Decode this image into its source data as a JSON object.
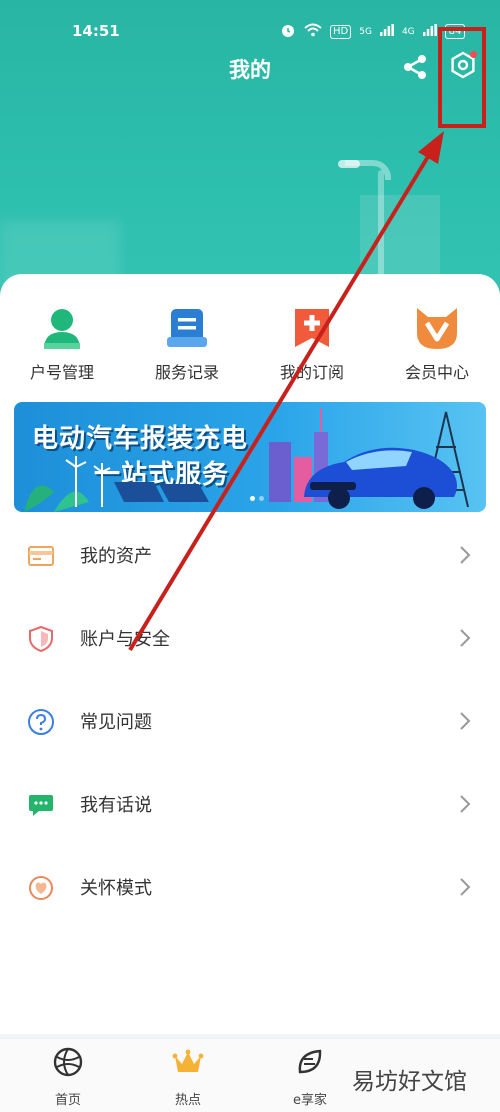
{
  "status_bar": {
    "time": "14:51",
    "network_hd": "HD",
    "signal1": "5G",
    "signal2": "4G",
    "battery": "84"
  },
  "header": {
    "title": "我的",
    "share_icon": "share-icon",
    "settings_icon": "gear-hexagon-icon",
    "bg_color": "#2cbcab"
  },
  "quick_actions": [
    {
      "label": "户号管理",
      "icon": "person-icon",
      "color": "#1fb87a"
    },
    {
      "label": "服务记录",
      "icon": "document-icon",
      "color": "#2a7fd4"
    },
    {
      "label": "我的订阅",
      "icon": "bookmark-plus-icon",
      "color": "#f15a3a"
    },
    {
      "label": "会员中心",
      "icon": "fox-v-icon",
      "color": "#f08a3c"
    }
  ],
  "banner": {
    "line1": "电动汽车报装充电",
    "line2": "一站式服务"
  },
  "menu": [
    {
      "label": "我的资产",
      "icon": "card-icon",
      "color": "#f0a35c"
    },
    {
      "label": "账户与安全",
      "icon": "shield-icon",
      "color": "#e86a6a"
    },
    {
      "label": "常见问题",
      "icon": "question-icon",
      "color": "#3d7fe0"
    },
    {
      "label": "我有话说",
      "icon": "chat-icon",
      "color": "#24b46c"
    },
    {
      "label": "关怀模式",
      "icon": "care-icon",
      "color": "#e88a5a"
    }
  ],
  "tabbar": [
    {
      "label": "首页",
      "icon": "globe-icon"
    },
    {
      "label": "热点",
      "icon": "crown-icon"
    },
    {
      "label": "e享家",
      "icon": "leaf-e-icon"
    }
  ],
  "watermark": "易坊好文馆",
  "annotation_color": "#c8211c"
}
